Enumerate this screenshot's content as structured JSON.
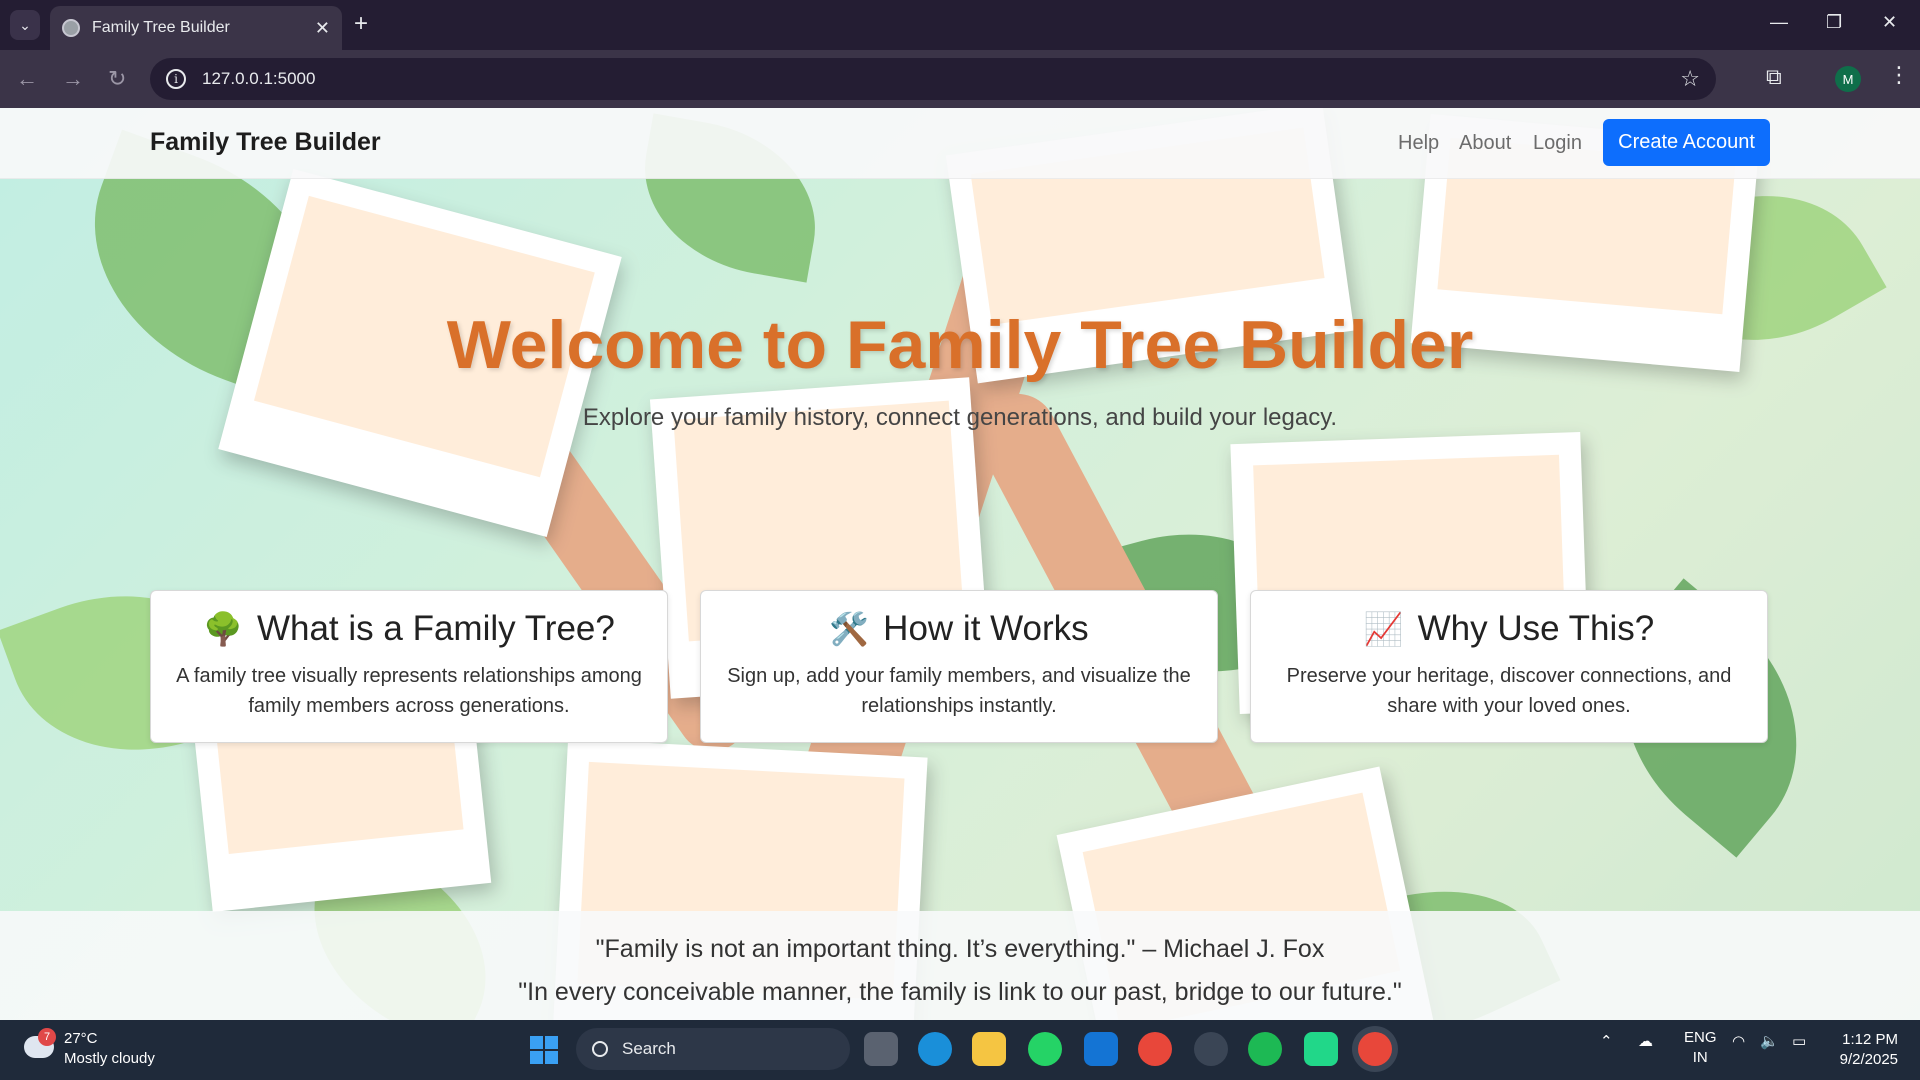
{
  "browser": {
    "tab_title": "Family Tree Builder",
    "url": "127.0.0.1:5000",
    "profile_initial": "M"
  },
  "site": {
    "brand": "Family Tree Builder",
    "nav": {
      "help": "Help",
      "about": "About",
      "login": "Login",
      "cta": "Create Account"
    },
    "hero": {
      "title": "Welcome to Family Tree Builder",
      "subtitle": "Explore your family history, connect generations, and build your legacy."
    },
    "cards": [
      {
        "emoji": "🌳",
        "title": "What is a Family Tree?",
        "text": "A family tree visually represents relationships among family members across generations."
      },
      {
        "emoji": "🛠️",
        "title": "How it Works",
        "text": "Sign up, add your family members, and visualize the relationships instantly."
      },
      {
        "emoji": "📈",
        "title": "Why Use This?",
        "text": "Preserve your heritage, discover connections, and share with your loved ones."
      }
    ],
    "quotes": [
      "\"Family is not an important thing. It’s everything.\" – Michael J. Fox",
      "\"In every conceivable manner, the family is link to our past, bridge to our future.\""
    ],
    "colors": {
      "hero_title": "#d9702a",
      "cta": "#0d6efd"
    }
  },
  "taskbar": {
    "weather_badge": "7",
    "temp": "27°C",
    "condition": "Mostly cloudy",
    "search_placeholder": "Search",
    "lang_top": "ENG",
    "lang_bottom": "IN",
    "time": "1:12 PM",
    "date": "9/2/2025"
  }
}
